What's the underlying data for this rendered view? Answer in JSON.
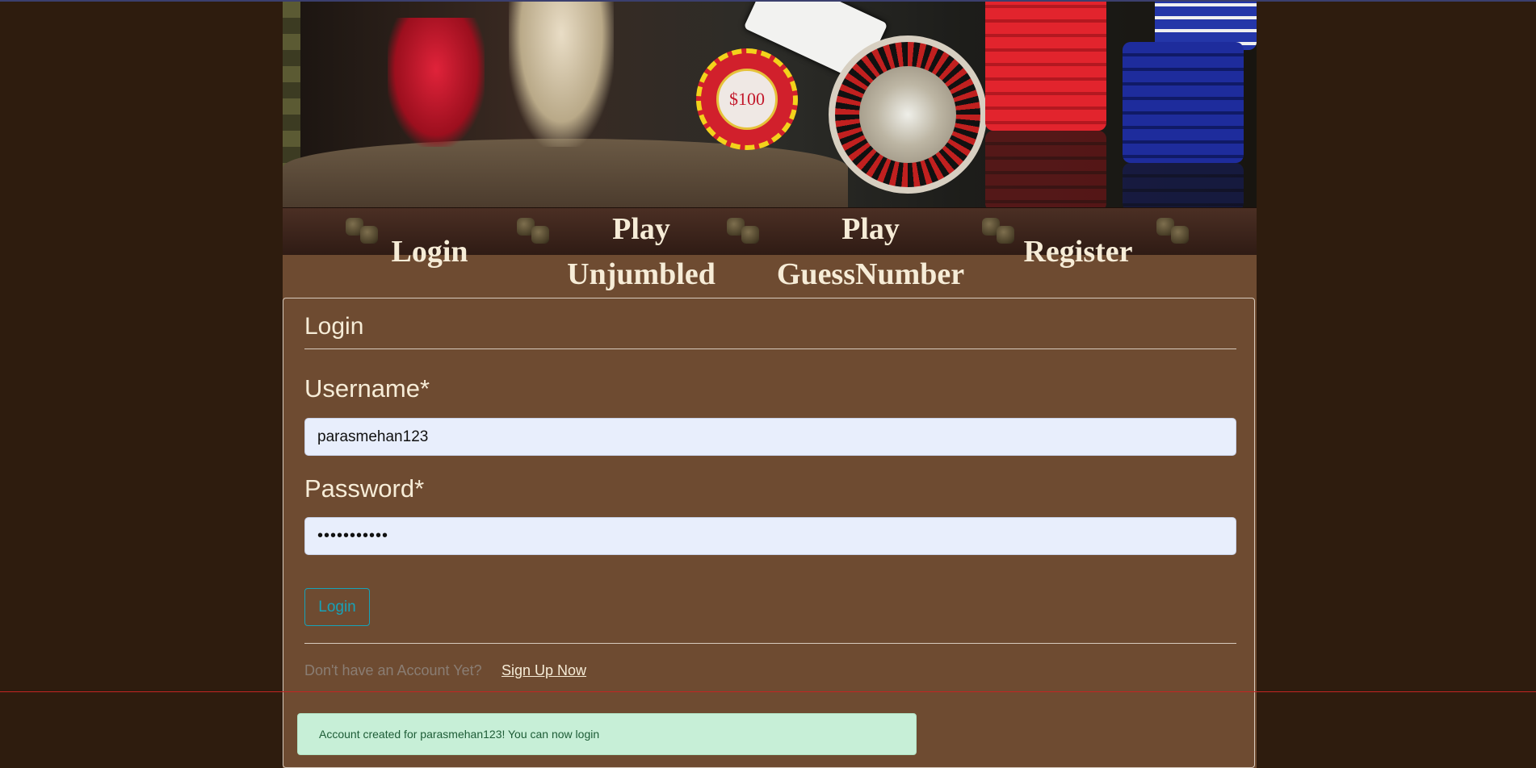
{
  "nav": {
    "items": [
      {
        "label": "Login"
      },
      {
        "label_line1": "Play",
        "label_line2": "Unjumbled"
      },
      {
        "label_line1": "Play",
        "label_line2": "GuessNumber"
      },
      {
        "label": "Register"
      }
    ]
  },
  "banner": {
    "chip_label": "$100"
  },
  "login_form": {
    "legend": "Login",
    "username_label": "Username*",
    "username_value": "parasmehan123",
    "password_label": "Password*",
    "password_value": "•••••••••••",
    "submit_label": "Login",
    "no_account_text": "Don't have an Account Yet?",
    "signup_link": "Sign Up Now"
  },
  "alert": {
    "message": "Account created for parasmehan123! You can now login"
  },
  "colors": {
    "page_bg": "#2e1c0e",
    "content_bg": "#6e4b31",
    "text_light": "#f6ecd7",
    "button_accent": "#17a2b8",
    "alert_bg": "#c7efd7",
    "alert_text": "#1d5c36"
  }
}
